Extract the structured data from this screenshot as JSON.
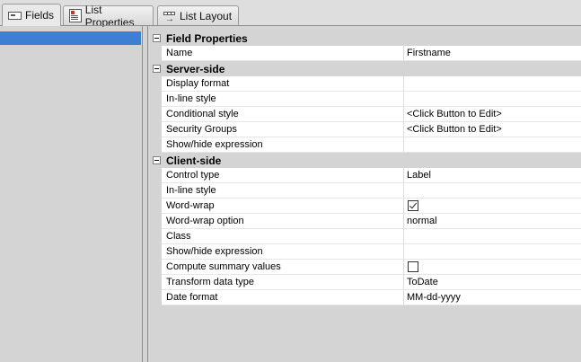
{
  "tabs": [
    {
      "label": "Fields",
      "icon": "fields-icon"
    },
    {
      "label": "List Properties",
      "icon": "list-properties-icon"
    },
    {
      "label": "List Layout",
      "icon": "list-layout-icon"
    }
  ],
  "colors": {
    "selection": "#3c7fd3",
    "background": "#d4d4d4"
  },
  "grid": {
    "field_properties": {
      "title": "Field Properties",
      "rows": [
        {
          "name": "Name",
          "value": "Firstname"
        }
      ]
    },
    "server_side": {
      "title": "Server-side",
      "rows": [
        {
          "name": "Display format",
          "value": ""
        },
        {
          "name": "In-line style",
          "value": ""
        },
        {
          "name": "Conditional style",
          "value": "<Click Button to Edit>"
        },
        {
          "name": "Security Groups",
          "value": "<Click Button to Edit>"
        },
        {
          "name": "Show/hide expression",
          "value": ""
        }
      ]
    },
    "client_side": {
      "title": "Client-side",
      "rows": [
        {
          "name": "Control type",
          "value": "Label"
        },
        {
          "name": "In-line style",
          "value": ""
        },
        {
          "name": "Word-wrap",
          "checkbox": true,
          "checked": true
        },
        {
          "name": "Word-wrap option",
          "value": "normal"
        },
        {
          "name": "Class",
          "value": ""
        },
        {
          "name": "Show/hide expression",
          "value": ""
        },
        {
          "name": "Compute summary values",
          "checkbox": true,
          "checked": false
        },
        {
          "name": "Transform data type",
          "value": "ToDate"
        },
        {
          "name": "Date format",
          "value": "MM-dd-yyyy"
        }
      ]
    }
  }
}
